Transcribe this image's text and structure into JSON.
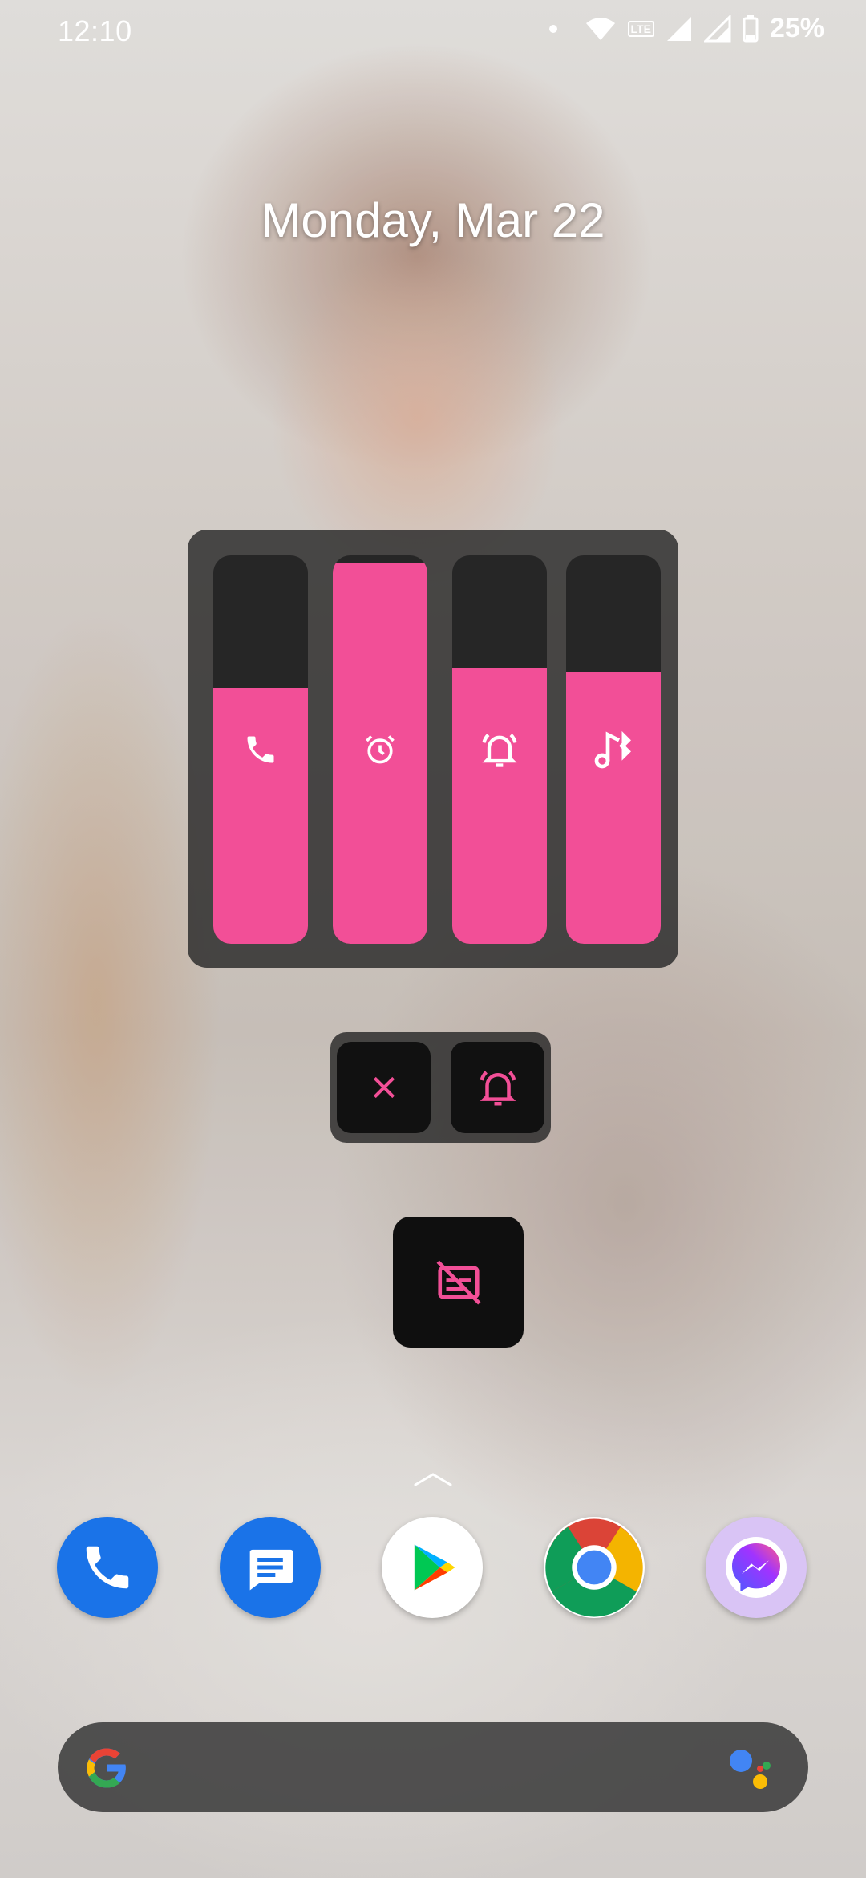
{
  "status_bar": {
    "time": "12:10",
    "network_badge": "LTE",
    "battery_percent": "25%",
    "icons": [
      "dot-icon",
      "wifi-icon",
      "volte-icon",
      "signal-icon",
      "signal-icon",
      "battery-icon"
    ]
  },
  "home": {
    "date": "Monday, Mar 22"
  },
  "volume_panel": {
    "accent_color": "#f24f97",
    "sliders": [
      {
        "name": "call",
        "icon": "phone-icon",
        "level_percent": 66
      },
      {
        "name": "alarm",
        "icon": "alarm-clock-icon",
        "level_percent": 98
      },
      {
        "name": "ring",
        "icon": "ring-bell-icon",
        "level_percent": 71
      },
      {
        "name": "media",
        "icon": "music-bluetooth-icon",
        "level_percent": 70
      }
    ]
  },
  "ringer_panel": {
    "buttons": [
      {
        "name": "close",
        "icon": "close-icon"
      },
      {
        "name": "ringer-mode",
        "icon": "ring-bell-icon"
      }
    ]
  },
  "captions_button": {
    "icon": "captions-off-icon"
  },
  "dock": {
    "apps": [
      {
        "name": "phone",
        "icon": "phone-app-icon",
        "color": "#1a73e8"
      },
      {
        "name": "messages",
        "icon": "messages-app-icon",
        "color": "#1a73e8"
      },
      {
        "name": "play-store",
        "icon": "play-store-icon",
        "color": "#ffffff"
      },
      {
        "name": "chrome",
        "icon": "chrome-icon",
        "color": "#ffffff"
      },
      {
        "name": "messenger",
        "icon": "messenger-icon",
        "color": "#d9c4f5"
      }
    ]
  },
  "search_bar": {
    "icons": [
      "google-g-icon",
      "assistant-icon"
    ]
  }
}
